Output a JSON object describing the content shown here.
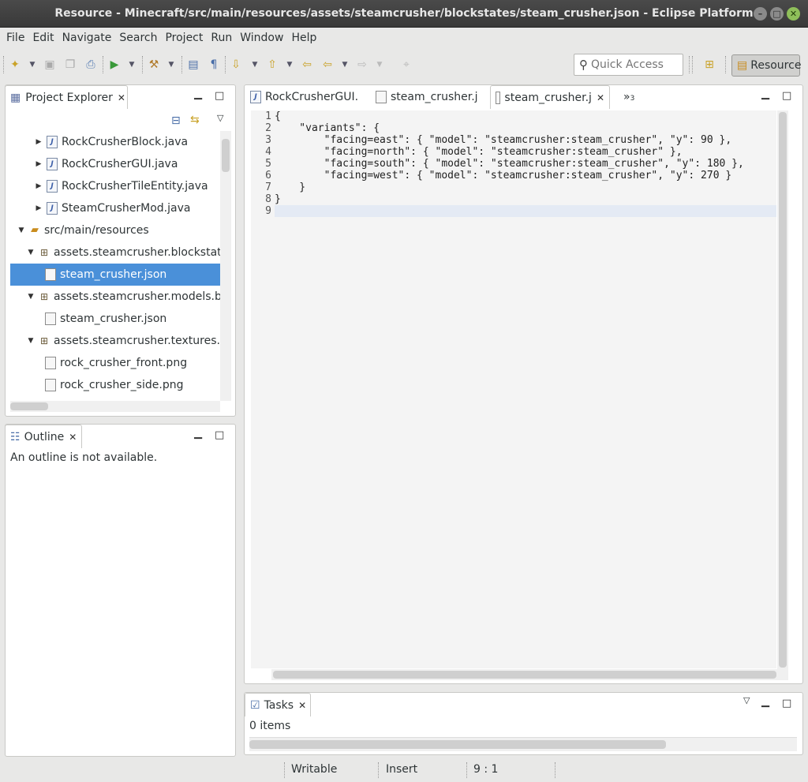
{
  "window": {
    "title": "Resource - Minecraft/src/main/resources/assets/steamcrusher/blockstates/steam_crusher.json - Eclipse Platform"
  },
  "menu": [
    "File",
    "Edit",
    "Navigate",
    "Search",
    "Project",
    "Run",
    "Window",
    "Help"
  ],
  "toolbar": {
    "quick_access_placeholder": "Quick Access",
    "perspective_label": "Resource"
  },
  "project_explorer": {
    "title": "Project Explorer",
    "items": [
      {
        "label": "RockCrusherBlock.java"
      },
      {
        "label": "RockCrusherGUI.java"
      },
      {
        "label": "RockCrusherTileEntity.java"
      },
      {
        "label": "SteamCrusherMod.java"
      },
      {
        "label": "src/main/resources"
      },
      {
        "label": "assets.steamcrusher.blockstates"
      },
      {
        "label": "steam_crusher.json"
      },
      {
        "label": "assets.steamcrusher.models.bloc"
      },
      {
        "label": "steam_crusher.json"
      },
      {
        "label": "assets.steamcrusher.textures.blo"
      },
      {
        "label": "rock_crusher_front.png"
      },
      {
        "label": "rock_crusher_side.png"
      }
    ]
  },
  "outline": {
    "title": "Outline",
    "message": "An outline is not available."
  },
  "editor": {
    "tabs": [
      {
        "label": "RockCrusherGUI."
      },
      {
        "label": "steam_crusher.j"
      },
      {
        "label": "steam_crusher.j"
      }
    ],
    "overflow_label": "»",
    "overflow_count": "3",
    "lines": [
      {
        "num": "1",
        "text": "{"
      },
      {
        "num": "2",
        "text": "    \"variants\": {"
      },
      {
        "num": "3",
        "text": "        \"facing=east\": { \"model\": \"steamcrusher:steam_crusher\", \"y\": 90 },"
      },
      {
        "num": "4",
        "text": "        \"facing=north\": { \"model\": \"steamcrusher:steam_crusher\" },"
      },
      {
        "num": "5",
        "text": "        \"facing=south\": { \"model\": \"steamcrusher:steam_crusher\", \"y\": 180 },"
      },
      {
        "num": "6",
        "text": "        \"facing=west\": { \"model\": \"steamcrusher:steam_crusher\", \"y\": 270 }"
      },
      {
        "num": "7",
        "text": "    }"
      },
      {
        "num": "8",
        "text": "}"
      },
      {
        "num": "9",
        "text": ""
      }
    ]
  },
  "tasks": {
    "title": "Tasks",
    "count": "0 items"
  },
  "status": {
    "writable": "Writable",
    "insert_mode": "Insert",
    "position": "9 : 1"
  },
  "colors": {
    "selection": "#4a90d9",
    "titlebar": "#3f3f3f",
    "close_button": "#8fbf5a"
  }
}
